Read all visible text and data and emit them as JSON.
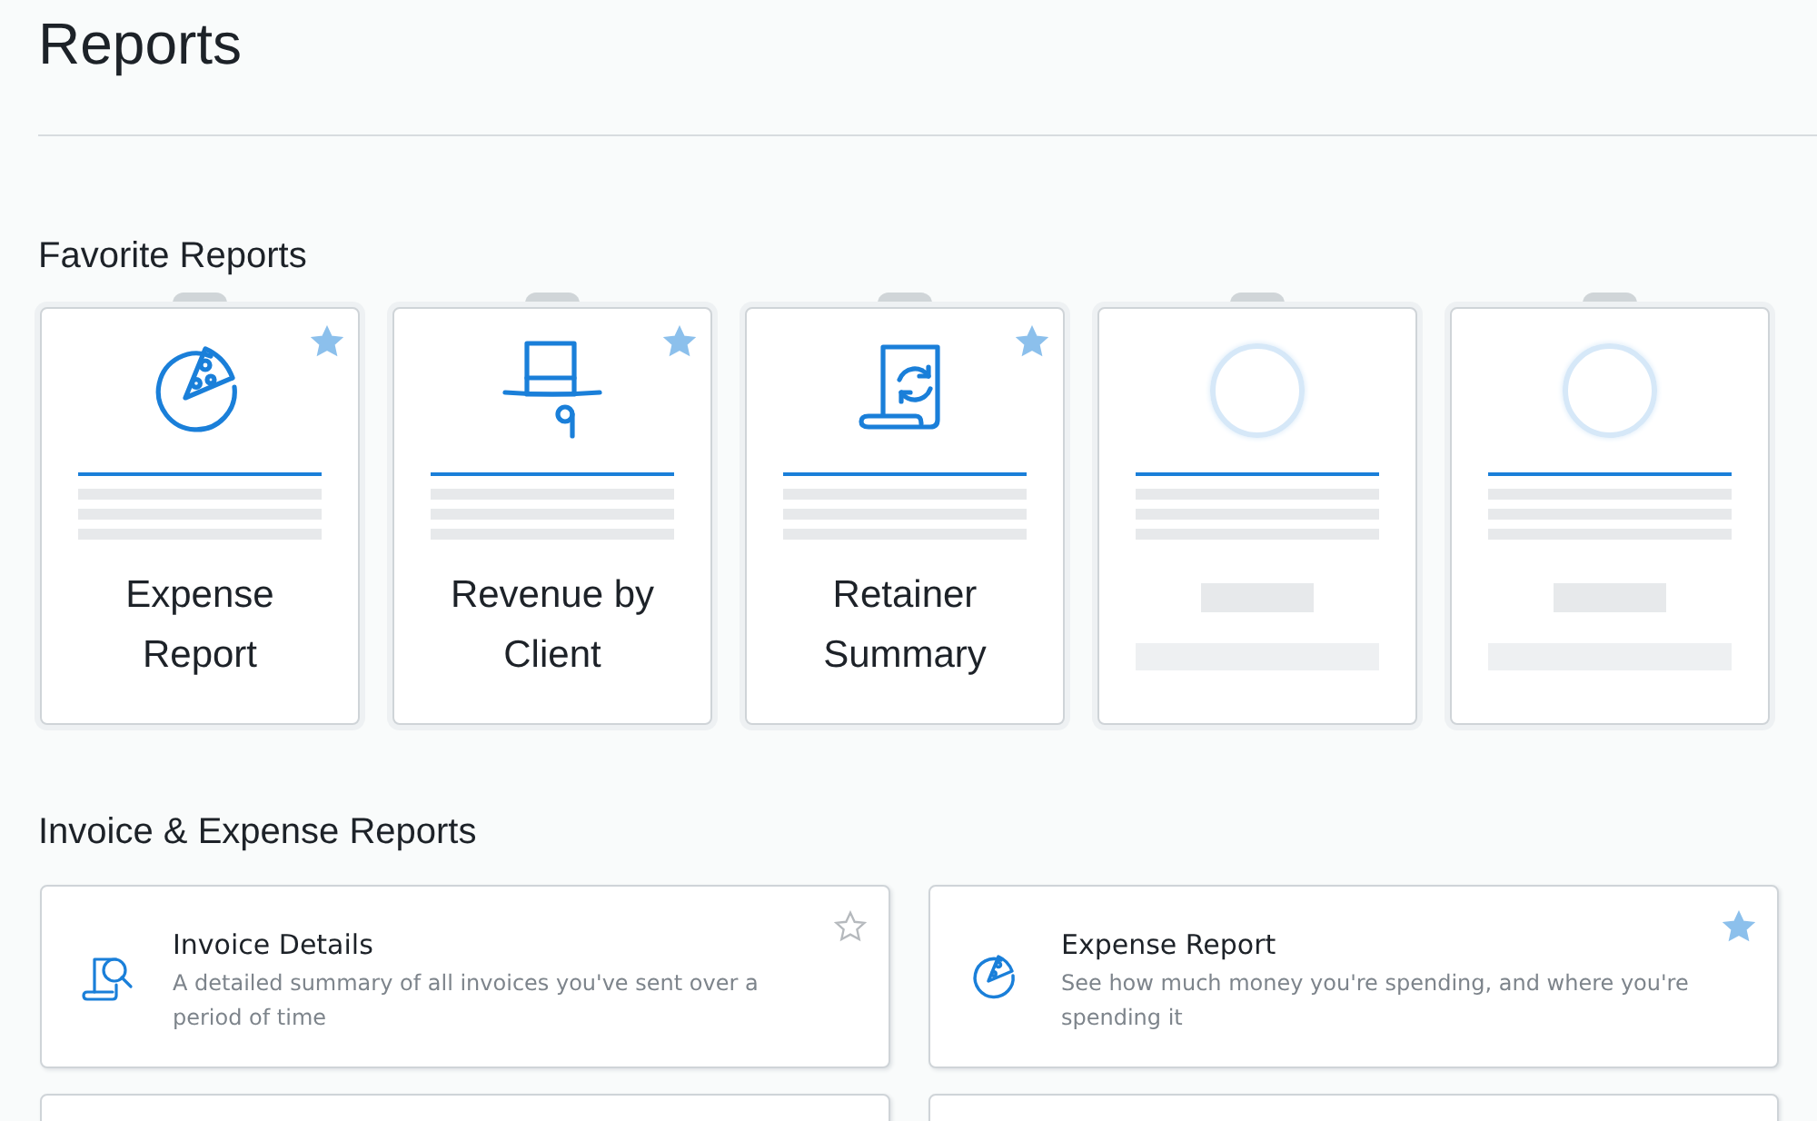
{
  "page_title": "Reports",
  "favorites": {
    "heading": "Favorite Reports",
    "cards": [
      {
        "kind": "report",
        "title": [
          "Expense",
          "Report"
        ],
        "favorite": true
      },
      {
        "kind": "report",
        "title": [
          "Revenue by",
          "Client"
        ],
        "favorite": true
      },
      {
        "kind": "report",
        "title": [
          "Retainer",
          "Summary"
        ],
        "favorite": true
      },
      {
        "kind": "placeholder"
      },
      {
        "kind": "placeholder"
      }
    ]
  },
  "section": {
    "heading": "Invoice & Expense Reports",
    "items": [
      {
        "title": "Invoice Details",
        "description": "A detailed summary of all invoices you've sent over a period of time",
        "favorite": false
      },
      {
        "title": "Expense Report",
        "description": "See how much money you're spending, and where you're spending it",
        "favorite": true
      }
    ]
  }
}
